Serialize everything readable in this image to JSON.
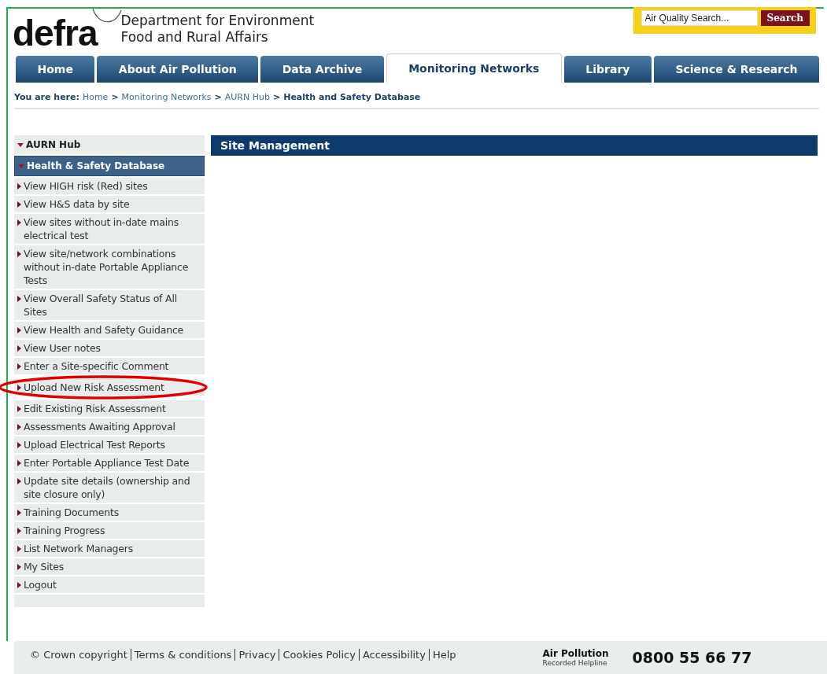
{
  "header": {
    "logo": "defra",
    "org_lines": [
      "Department for Environment",
      "Food and Rural Affairs"
    ],
    "search": {
      "placeholder": "Air Quality Search...",
      "button": "Search"
    }
  },
  "tabs": [
    {
      "label": "Home",
      "selected": false
    },
    {
      "label": "About Air Pollution",
      "selected": false
    },
    {
      "label": "Data Archive",
      "selected": false
    },
    {
      "label": "Monitoring Networks",
      "selected": true
    },
    {
      "label": "Library",
      "selected": false
    },
    {
      "label": "Science & Research",
      "selected": false
    }
  ],
  "breadcrumb": {
    "label": "You are here:",
    "items": [
      {
        "kind": "link",
        "text": "Home"
      },
      {
        "kind": "sep",
        "text": ">"
      },
      {
        "kind": "link",
        "text": "Monitoring Networks"
      },
      {
        "kind": "sep",
        "text": ">"
      },
      {
        "kind": "link",
        "text": "AURN Hub"
      },
      {
        "kind": "sep",
        "text": ">"
      },
      {
        "kind": "current",
        "text": "Health and Safety Database"
      }
    ]
  },
  "sidebar": {
    "sections": [
      {
        "label": "AURN Hub",
        "selected": false,
        "expanded": true
      },
      {
        "label": "Health & Safety Database",
        "selected": true,
        "expanded": true
      }
    ],
    "items": [
      {
        "label": "View HIGH risk (Red) sites",
        "highlighted": false
      },
      {
        "label": "View H&S data by site",
        "highlighted": false
      },
      {
        "label": "View sites without in-date mains electrical test",
        "highlighted": false
      },
      {
        "label": "View site/network combinations without in-date Portable Appliance Tests",
        "highlighted": false
      },
      {
        "label": "View Overall Safety Status of All Sites",
        "highlighted": false
      },
      {
        "label": "View Health and Safety Guidance",
        "highlighted": false
      },
      {
        "label": "View User notes",
        "highlighted": false
      },
      {
        "label": "Enter a Site-specific Comment",
        "highlighted": false
      },
      {
        "label": "Upload New Risk Assessment",
        "highlighted": true
      },
      {
        "label": "Edit Existing Risk Assessment",
        "highlighted": false
      },
      {
        "label": "Assessments Awaiting Approval",
        "highlighted": false
      },
      {
        "label": "Upload Electrical Test Reports",
        "highlighted": false
      },
      {
        "label": "Enter Portable Appliance Test Date",
        "highlighted": false
      },
      {
        "label": "Update site details (ownership and site closure only)",
        "highlighted": false
      },
      {
        "label": "Training Documents",
        "highlighted": false
      },
      {
        "label": "Training Progress",
        "highlighted": false
      },
      {
        "label": "List Network Managers",
        "highlighted": false
      },
      {
        "label": "My Sites",
        "highlighted": false
      },
      {
        "label": "Logout",
        "highlighted": false
      }
    ]
  },
  "main": {
    "heading": "Site Management"
  },
  "footer": {
    "links": [
      "© Crown copyright",
      "Terms & conditions",
      "Privacy",
      "Cookies Policy",
      "Accessibility",
      "Help"
    ],
    "helpline": {
      "title": "Air Pollution",
      "subtitle": "Recorded Helpline",
      "phone": "0800 55 66 77"
    }
  }
}
